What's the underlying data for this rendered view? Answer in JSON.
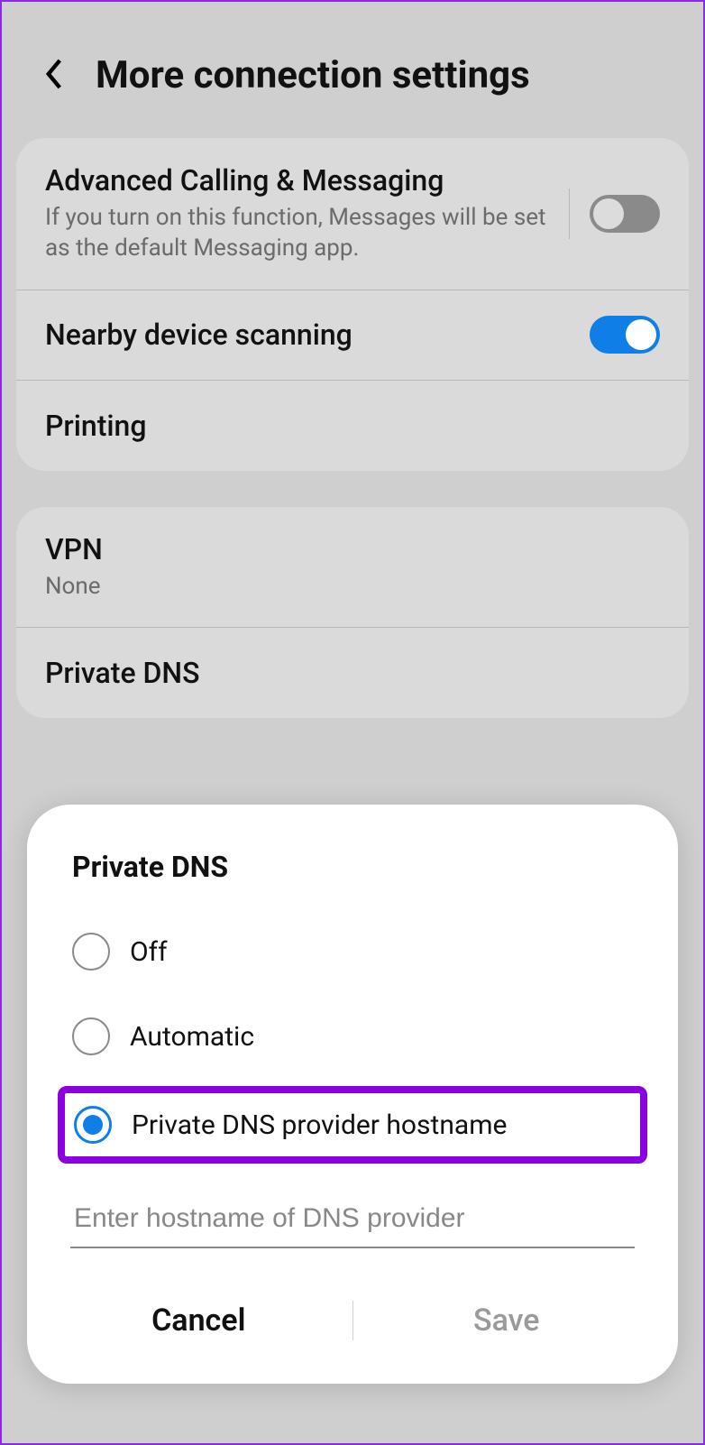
{
  "header": {
    "title": "More connection settings"
  },
  "card1": {
    "advanced_calling": {
      "title": "Advanced Calling & Messaging",
      "sub": "If you turn on this function, Messages will be set as the default Messaging app."
    },
    "nearby_scanning": {
      "title": "Nearby device scanning"
    },
    "printing": {
      "title": "Printing"
    }
  },
  "card2": {
    "vpn": {
      "title": "VPN",
      "sub": "None"
    },
    "private_dns": {
      "title": "Private DNS"
    }
  },
  "dialog": {
    "title": "Private DNS",
    "options": {
      "off": "Off",
      "automatic": "Automatic",
      "hostname": "Private DNS provider hostname"
    },
    "input_placeholder": "Enter hostname of DNS provider",
    "cancel": "Cancel",
    "save": "Save"
  }
}
